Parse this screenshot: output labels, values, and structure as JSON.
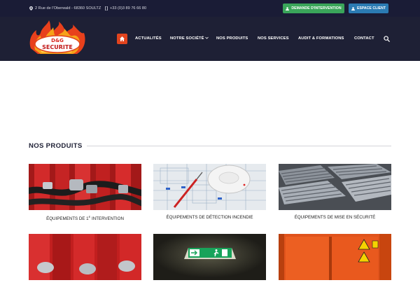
{
  "topbar": {
    "address": "2 Rue de l'Oberwald - 68360 SOULTZ",
    "phone": "+33 (0)3 89 76 66 80",
    "btn_demande": "DEMANDE D'INTERVENTION",
    "btn_espace": "ESPACE CLIENT",
    "colors": {
      "background": "#1a1c36",
      "demande": "#3aa55a",
      "espace": "#2b7bb3"
    }
  },
  "logo": {
    "text_top": "D&G",
    "text_main": "SECURITE",
    "icons": [
      "flame-icon"
    ]
  },
  "nav": {
    "items": [
      "ACTUALITÉS",
      "NOTRE SOCIÉTÉ",
      "NOS PRODUITS",
      "NOS SERVICES",
      "AUDIT & FORMATIONS",
      "CONTACT"
    ],
    "home_icon": "home-icon",
    "search_icon": "search-icon",
    "accent": "#e2441e"
  },
  "section": {
    "title": "NOS PRODUITS"
  },
  "products": [
    {
      "label_pre": "ÉQUIPEMENTS DE 1",
      "label_sup": "E",
      "label_post": " INTERVENTION"
    },
    {
      "label": "ÉQUIPEMENTS DE DÉTECTION INCENDIE"
    },
    {
      "label": "ÉQUIPEMENTS DE MISE EN SÉCURITÉ"
    },
    {
      "label": ""
    },
    {
      "label": ""
    },
    {
      "label": ""
    }
  ]
}
